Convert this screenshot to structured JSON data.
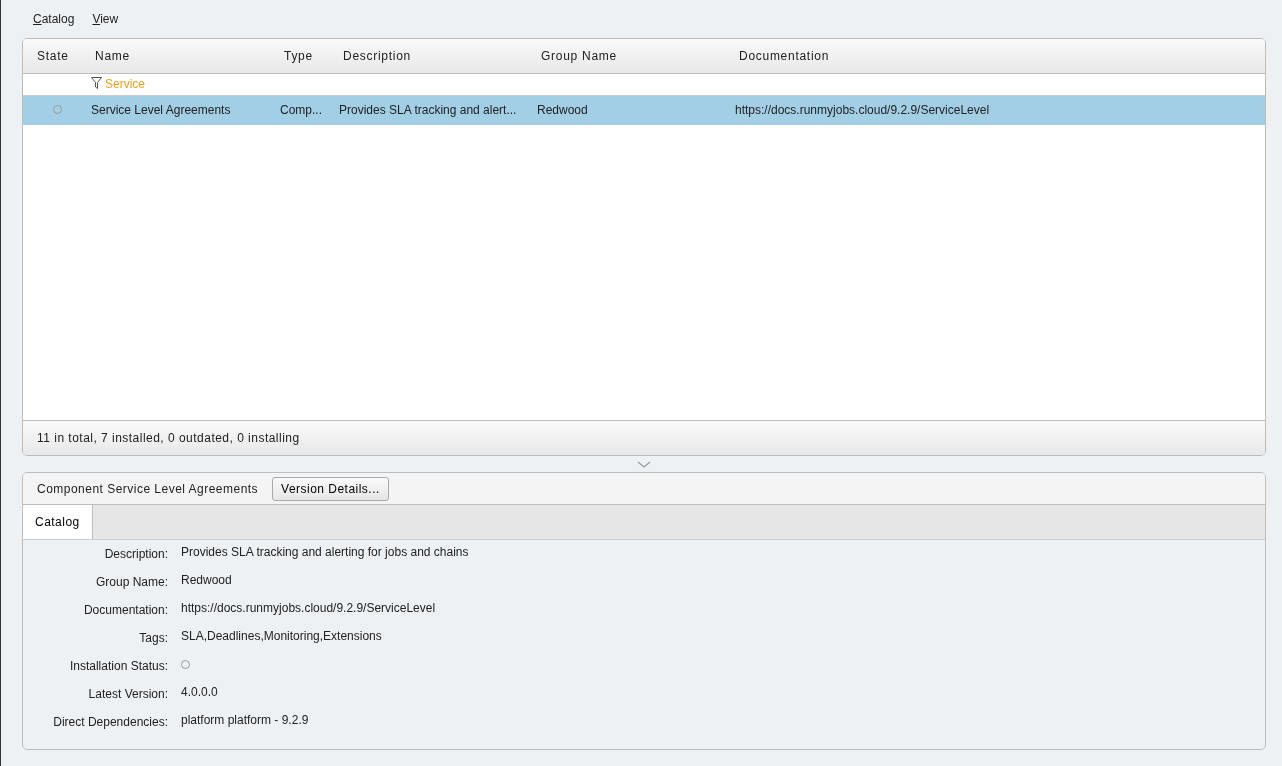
{
  "menu": [
    {
      "label": "Catalog"
    },
    {
      "label": "View"
    }
  ],
  "table": {
    "columns": [
      "State",
      "Name",
      "Type",
      "Description",
      "Group Name",
      "Documentation"
    ],
    "filter": {
      "text": "Service"
    },
    "rows": [
      {
        "selected": true,
        "installed": false,
        "cells": [
          "",
          "Service Level Agreements",
          "Comp...",
          "Provides SLA tracking and alert...",
          "Redwood",
          "https://docs.runmyjobs.cloud/9.2.9/ServiceLevel"
        ]
      }
    ]
  },
  "status_bar": "11 in total, 7 installed, 0 outdated, 0 installing",
  "details": {
    "title": "Component Service Level Agreements",
    "button": "Version Details...",
    "tabs": [
      {
        "label": "Catalog",
        "selected": true
      }
    ],
    "fields": [
      {
        "kind": "text",
        "label": "Description:",
        "value": "Provides SLA tracking and alerting for jobs and chains"
      },
      {
        "kind": "text",
        "label": "Group Name:",
        "value": "Redwood"
      },
      {
        "kind": "text",
        "label": "Documentation:",
        "value": "https://docs.runmyjobs.cloud/9.2.9/ServiceLevel"
      },
      {
        "kind": "text",
        "label": "Tags:",
        "value": "SLA,Deadlines,Monitoring,Extensions"
      },
      {
        "kind": "status",
        "label": "Installation Status:",
        "installed": false
      },
      {
        "kind": "text",
        "label": "Latest Version:",
        "value": "4.0.0.0"
      },
      {
        "kind": "text",
        "label": "Direct Dependencies:",
        "value": "platform platform - 9.2.9"
      }
    ]
  }
}
